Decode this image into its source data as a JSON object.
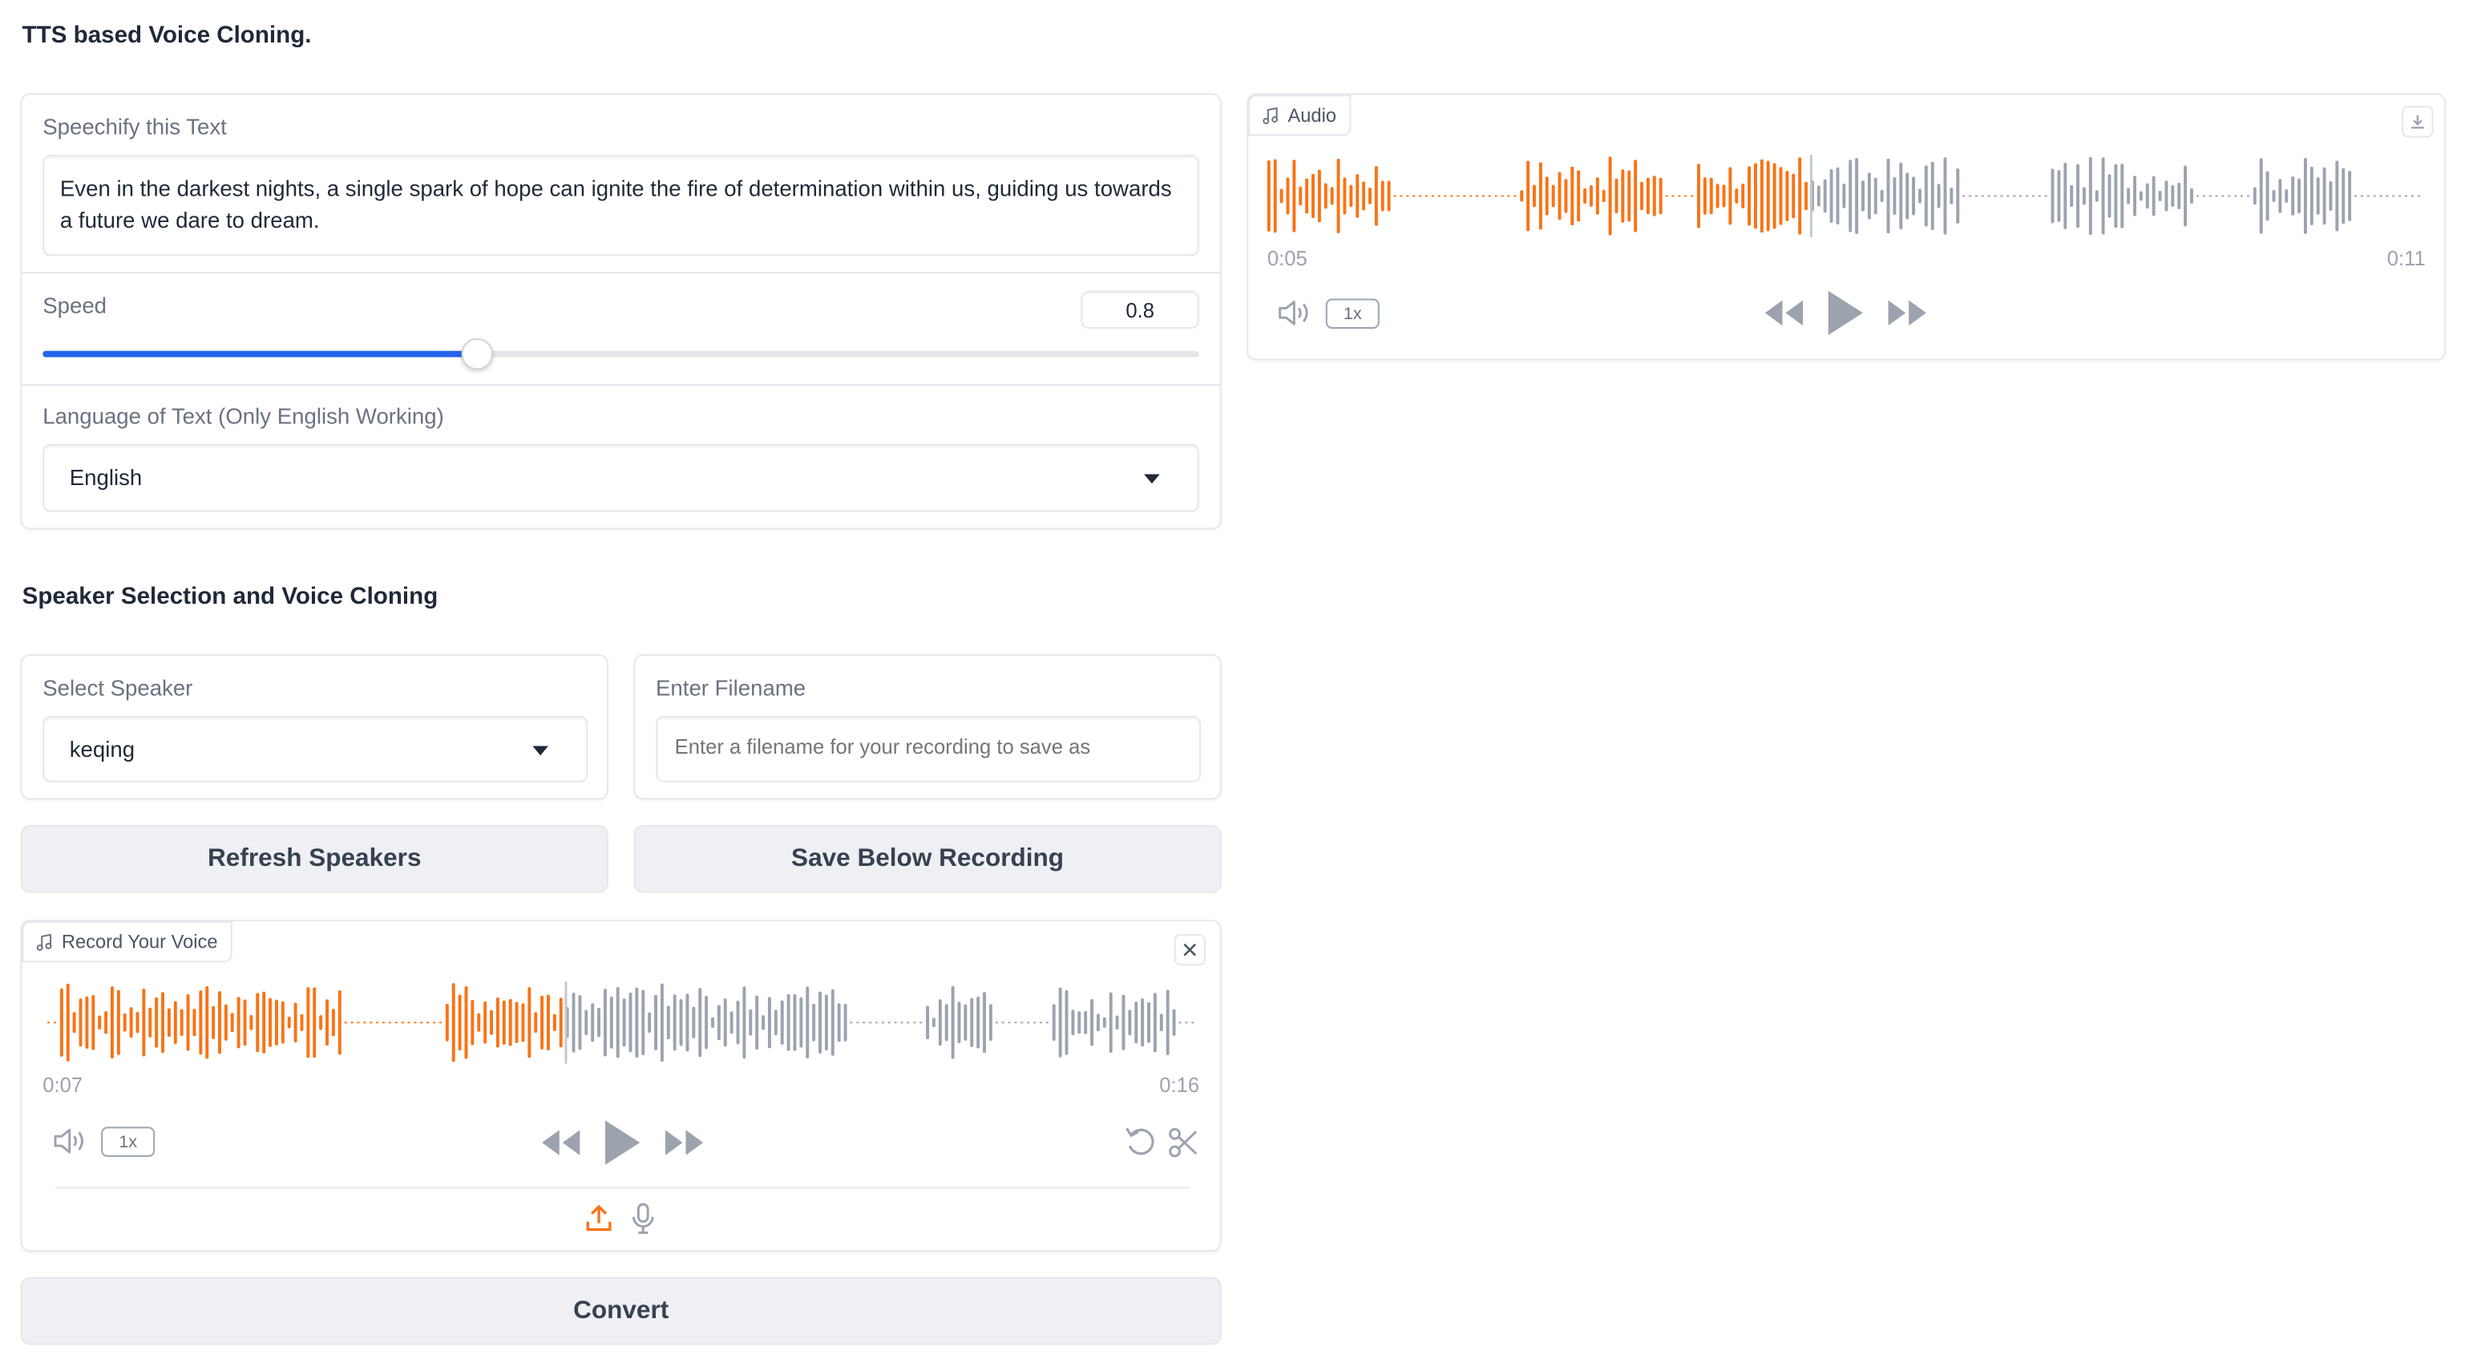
{
  "page": {
    "title": "TTS based Voice Cloning."
  },
  "tts": {
    "text_label": "Speechify this Text",
    "text_value": "Even in the darkest nights, a single spark of hope can ignite the fire of determination within us, guiding us towards a future we dare to dream.",
    "speed_label": "Speed",
    "speed_value": "0.8",
    "speed_fraction": 0.375,
    "language_label": "Language of Text (Only English Working)",
    "language_value": "English"
  },
  "output_audio": {
    "tag": "Audio",
    "current_time": "0:05",
    "duration": "0:11",
    "rate": "1x",
    "progress": 0.47
  },
  "speaker_section": {
    "heading": "Speaker Selection and Voice Cloning",
    "select_label": "Select Speaker",
    "select_value": "keqing",
    "filename_label": "Enter Filename",
    "filename_placeholder": "Enter a filename for your recording to save as",
    "refresh_button": "Refresh Speakers",
    "save_button": "Save Below Recording"
  },
  "record_audio": {
    "tag": "Record Your Voice",
    "current_time": "0:07",
    "duration": "0:16",
    "rate": "1x",
    "progress": 0.45
  },
  "convert_button": "Convert",
  "colors": {
    "accent": "#f97316",
    "slider": "#2563eb",
    "wave_gray": "#9ca3af"
  },
  "icons": [
    "music-note-icon",
    "download-icon",
    "close-icon",
    "volume-icon",
    "rewind-icon",
    "play-icon",
    "fast-forward-icon",
    "undo-icon",
    "scissors-icon",
    "upload-icon",
    "microphone-icon",
    "chevron-down-icon"
  ]
}
